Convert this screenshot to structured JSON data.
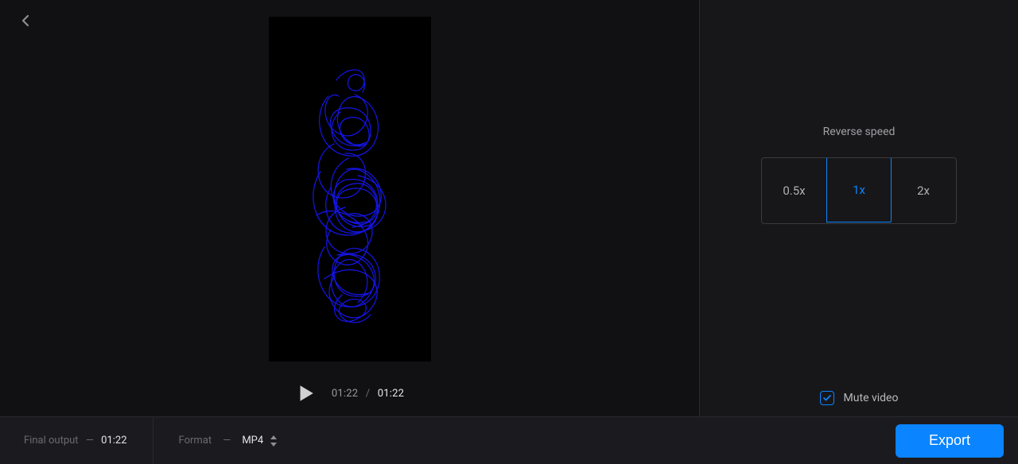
{
  "playbar": {
    "current_time": "01:22",
    "separator": "/",
    "duration": "01:22"
  },
  "side": {
    "title": "Reverse speed",
    "speeds": [
      "0.5x",
      "1x",
      "2x"
    ],
    "selected_speed_index": 1,
    "mute": {
      "label": "Mute video",
      "checked": true
    }
  },
  "footer": {
    "final_output_label": "Final output",
    "final_output_value": "01:22",
    "format_label": "Format",
    "format_value": "MP4",
    "export_label": "Export"
  }
}
